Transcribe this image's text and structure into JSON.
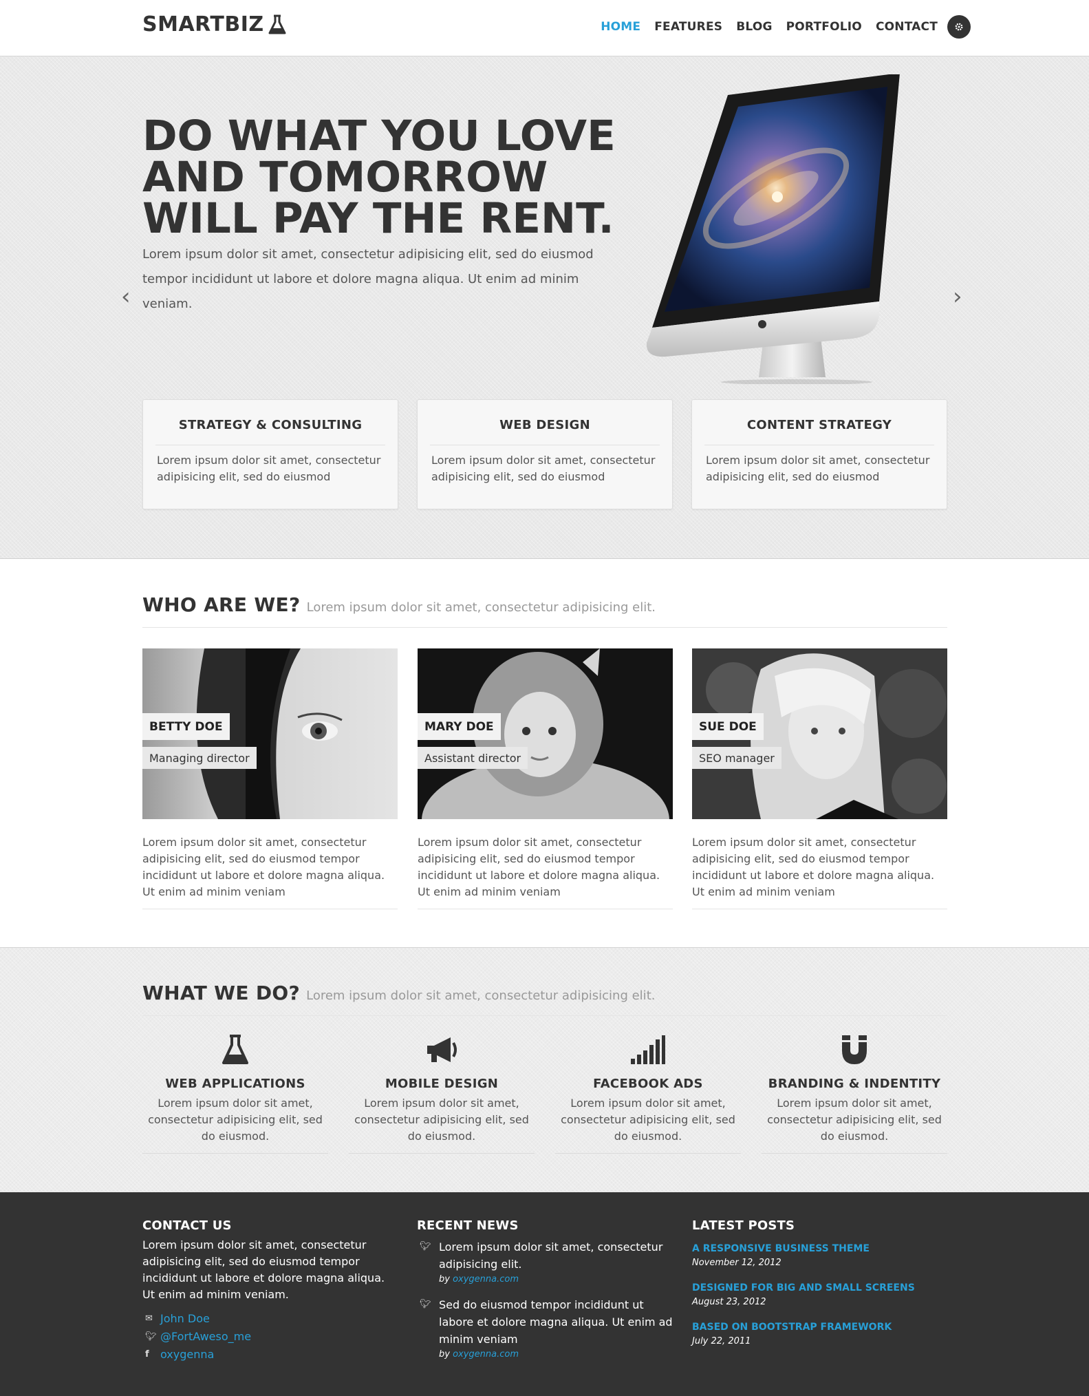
{
  "brand": {
    "name": "SMARTBIZ",
    "accent": "#28a0d8"
  },
  "nav": {
    "items": [
      {
        "label": "HOME",
        "active": true
      },
      {
        "label": "FEATURES",
        "active": false
      },
      {
        "label": "BLOG",
        "active": false
      },
      {
        "label": "PORTFOLIO",
        "active": false
      },
      {
        "label": "CONTACT",
        "active": false
      }
    ],
    "settings_icon": "gear-icon"
  },
  "hero": {
    "title": "DO WHAT YOU LOVE\nAND TOMORROW\nWILL PAY THE RENT.",
    "text": "Lorem ipsum dolor sit amet, consectetur adipisicing elit, sed do eiusmod tempor incididunt ut labore et dolore magna aliqua. Ut enim ad minim veniam.",
    "prev_icon": "chevron-left-icon",
    "next_icon": "chevron-right-icon"
  },
  "services": [
    {
      "title": "STRATEGY & CONSULTING",
      "text": "Lorem ipsum dolor sit amet, consectetur adipisicing elit, sed do eiusmod"
    },
    {
      "title": "WEB DESIGN",
      "text": "Lorem ipsum dolor sit amet, consectetur adipisicing elit, sed do eiusmod"
    },
    {
      "title": "CONTENT STRATEGY",
      "text": "Lorem ipsum dolor sit amet, consectetur adipisicing elit, sed do eiusmod"
    }
  ],
  "who": {
    "heading": "WHO ARE WE?",
    "subheading": "Lorem ipsum dolor sit amet, consectetur adipisicing elit.",
    "people": [
      {
        "name": "BETTY DOE",
        "role": "Managing director",
        "text": "Lorem ipsum dolor sit amet, consectetur adipisicing elit, sed do eiusmod tempor incididunt ut labore et dolore magna aliqua. Ut enim ad minim veniam"
      },
      {
        "name": "MARY DOE",
        "role": "Assistant director",
        "text": "Lorem ipsum dolor sit amet, consectetur adipisicing elit, sed do eiusmod tempor incididunt ut labore et dolore magna aliqua. Ut enim ad minim veniam"
      },
      {
        "name": "SUE DOE",
        "role": "SEO manager",
        "text": "Lorem ipsum dolor sit amet, consectetur adipisicing elit, sed do eiusmod tempor incididunt ut labore et dolore magna aliqua. Ut enim ad minim veniam"
      }
    ]
  },
  "what": {
    "heading": "WHAT WE DO?",
    "subheading": "Lorem ipsum dolor sit amet, consectetur adipisicing elit.",
    "features": [
      {
        "icon": "flask-icon",
        "title": "WEB APPLICATIONS",
        "text": "Lorem ipsum dolor sit amet, consectetur adipisicing elit, sed do eiusmod."
      },
      {
        "icon": "megaphone-icon",
        "title": "MOBILE DESIGN",
        "text": "Lorem ipsum dolor sit amet, consectetur adipisicing elit, sed do eiusmod."
      },
      {
        "icon": "signal-bars-icon",
        "title": "FACEBOOK ADS",
        "text": "Lorem ipsum dolor sit amet, consectetur adipisicing elit, sed do eiusmod."
      },
      {
        "icon": "magnet-icon",
        "title": "BRANDING & INDENTITY",
        "text": "Lorem ipsum dolor sit amet, consectetur adipisicing elit, sed do eiusmod."
      }
    ]
  },
  "footer": {
    "contact": {
      "heading": "CONTACT US",
      "text": "Lorem ipsum dolor sit amet, consectetur adipisicing elit, sed do eiusmod tempor incididunt ut labore et dolore magna aliqua. Ut enim ad minim veniam.",
      "lines": [
        {
          "icon": "envelope-icon",
          "label": "John Doe"
        },
        {
          "icon": "twitter-icon",
          "label": "@FortAweso_me"
        },
        {
          "icon": "facebook-icon",
          "label": "oxygenna"
        }
      ]
    },
    "news": {
      "heading": "RECENT NEWS",
      "items": [
        {
          "icon": "twitter-icon",
          "text": "Lorem ipsum dolor sit amet, consectetur adipisicing elit.",
          "by_prefix": "by",
          "by_link": "oxygenna.com"
        },
        {
          "icon": "twitter-icon",
          "text": "Sed do eiusmod tempor incididunt ut labore et dolore magna aliqua. Ut enim ad minim veniam",
          "by_prefix": "by",
          "by_link": "oxygenna.com"
        }
      ]
    },
    "posts": {
      "heading": "LATEST POSTS",
      "items": [
        {
          "title": "A RESPONSIVE BUSINESS THEME",
          "date": "November 12, 2012"
        },
        {
          "title": "DESIGNED FOR BIG AND SMALL SCREENS",
          "date": "August 23, 2012"
        },
        {
          "title": "BASED ON BOOTSTRAP FRAMEWORK",
          "date": "July 22, 2011"
        }
      ]
    }
  }
}
